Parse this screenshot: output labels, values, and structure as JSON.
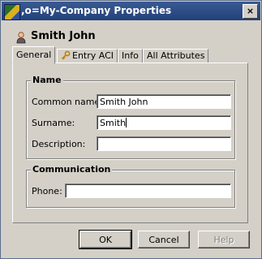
{
  "window": {
    "title": ",o=My-Company Properties",
    "close_glyph": "×",
    "app_icon": "directory-app-icon"
  },
  "header": {
    "user_name": "Smith John",
    "user_icon": "user-icon"
  },
  "tabs": [
    {
      "label": "General",
      "active": true
    },
    {
      "label": "Entry ACI",
      "active": false,
      "icon": "key-icon"
    },
    {
      "label": "Info",
      "active": false
    },
    {
      "label": "All Attributes",
      "active": false
    }
  ],
  "name_group": {
    "title": "Name",
    "common_name": {
      "label": "Common name:",
      "value": "Smith John"
    },
    "surname": {
      "label": "Surname:",
      "value": "Smith"
    },
    "description": {
      "label": "Description:",
      "value": ""
    }
  },
  "communication_group": {
    "title": "Communication",
    "phone": {
      "label": "Phone:",
      "value": ""
    }
  },
  "buttons": {
    "ok": "OK",
    "cancel": "Cancel",
    "help": "Help"
  },
  "colors": {
    "titlebar": "#2c4b85",
    "face": "#d4d0c8"
  }
}
